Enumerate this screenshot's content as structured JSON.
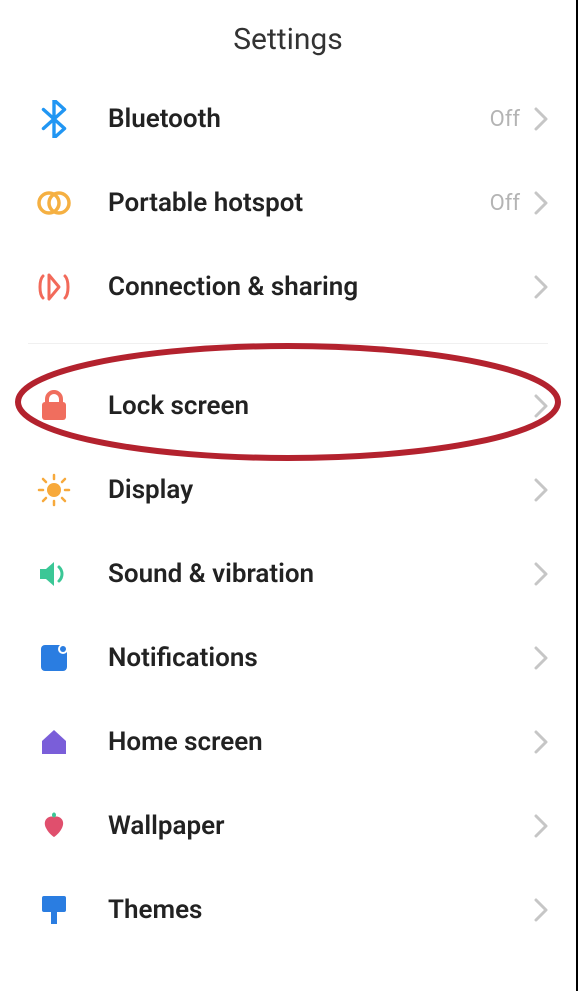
{
  "header": {
    "title": "Settings"
  },
  "status": {
    "off": "Off"
  },
  "items": {
    "bluetooth": "Bluetooth",
    "hotspot": "Portable hotspot",
    "connection": "Connection & sharing",
    "lockscreen": "Lock screen",
    "display": "Display",
    "sound": "Sound & vibration",
    "notifications": "Notifications",
    "homescreen": "Home screen",
    "wallpaper": "Wallpaper",
    "themes": "Themes"
  },
  "colors": {
    "blue": "#2196f3",
    "orange": "#f5b042",
    "coral": "#f26a5a",
    "salmon": "#f06e5e",
    "sunOrange": "#f7a93b",
    "teal": "#3bc796",
    "blue2": "#2a7de1",
    "purple": "#7a5ed9",
    "rose": "#e04f6d",
    "blue3": "#2a7de1",
    "chevron": "#c6c6c6",
    "circle": "#b3222e"
  }
}
